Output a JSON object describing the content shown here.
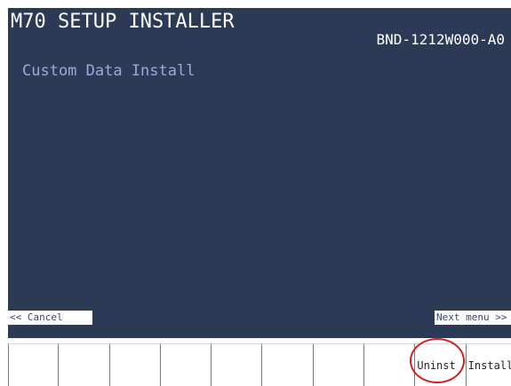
{
  "header": {
    "title": "M70 SETUP INSTALLER",
    "version": "BND-1212W000-A0"
  },
  "main": {
    "subtitle": "Custom Data Install"
  },
  "nav": {
    "cancel_label": "<< Cancel",
    "next_label": "Next menu >>"
  },
  "function_keys": {
    "f1": "",
    "f2": "",
    "f3": "",
    "f4": "",
    "f5": "",
    "f6": "",
    "f7": "",
    "f8": "",
    "f9": "Uninst",
    "f10": "Install"
  },
  "colors": {
    "screen_background": "#2c3a55",
    "subtitle_text": "#9aaadf",
    "highlight_circle": "#d61e1e"
  }
}
